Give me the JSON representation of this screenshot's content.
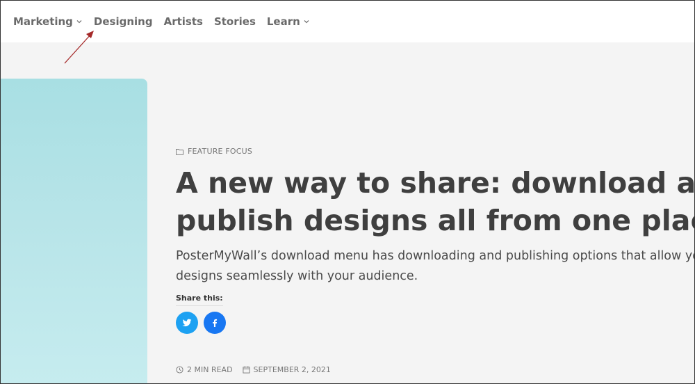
{
  "nav": {
    "items": [
      {
        "label": "Marketing",
        "has_dropdown": true
      },
      {
        "label": "Designing",
        "has_dropdown": false
      },
      {
        "label": "Artists",
        "has_dropdown": false
      },
      {
        "label": "Stories",
        "has_dropdown": false
      },
      {
        "label": "Learn",
        "has_dropdown": true
      }
    ]
  },
  "article": {
    "category": "FEATURE FOCUS",
    "title_line1": "A new way to share: download and",
    "title_line2": "publish designs all from one place!",
    "excerpt_line1": "PosterMyWall’s download menu has downloading and publishing options that allow you",
    "excerpt_line2": "designs seamlessly with your audience.",
    "share_label": "Share this:",
    "read_time": "2 MIN READ",
    "date": "SEPTEMBER 2, 2021"
  },
  "icons": {
    "category": "folder-icon",
    "twitter": "twitter-icon",
    "facebook": "facebook-icon",
    "clock": "clock-icon",
    "calendar": "calendar-icon",
    "chevron": "chevron-down-icon",
    "annotation": "arrow-annotation-icon"
  },
  "colors": {
    "twitter": "#1da1f2",
    "facebook": "#1877f2",
    "annotation_arrow": "#a52a2a",
    "hero": "#b7e4e8"
  }
}
